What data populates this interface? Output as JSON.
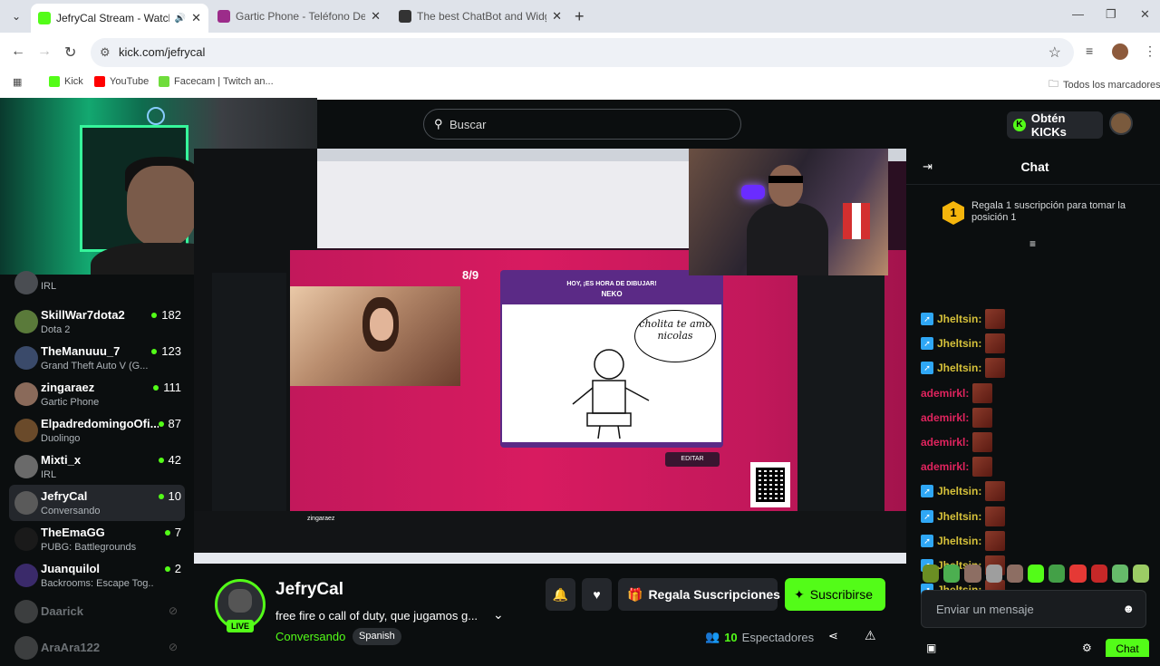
{
  "browser": {
    "tabs": [
      {
        "title": "JefryCal Stream - Watch Live",
        "active": true,
        "favicon_color": "#53fc18"
      },
      {
        "title": "Gartic Phone - Teléfono Descompuesto",
        "active": false,
        "favicon_color": "#9c2c8a"
      },
      {
        "title": "The best ChatBot and Widgets",
        "active": false,
        "favicon_color": "#333333"
      }
    ],
    "url": "kick.com/jefrycal",
    "bookmarks": [
      {
        "label": "Kick",
        "icon_color": "#53fc18"
      },
      {
        "label": "YouTube",
        "icon_color": "#ff0000"
      },
      {
        "label": "Facecam | Twitch an...",
        "icon_color": "#6fdc3c"
      }
    ],
    "all_bookmarks": "Todos los marcadores"
  },
  "header": {
    "search_placeholder": "Buscar",
    "kicks_label": "Obtén KICKs"
  },
  "sidebar": {
    "channels": [
      {
        "name": "",
        "category": "IRL",
        "viewers": "",
        "avatar_color": "#4a4d52",
        "partial": true
      },
      {
        "name": "SkillWar7dota2",
        "category": "Dota 2",
        "viewers": "182",
        "avatar_color": "#5a7a3a"
      },
      {
        "name": "TheManuuu_7",
        "category": "Grand Theft Auto V (G...",
        "viewers": "123",
        "avatar_color": "#3a4a6a"
      },
      {
        "name": "zingaraez",
        "category": "Gartic Phone",
        "viewers": "111",
        "avatar_color": "#8a6a5a"
      },
      {
        "name": "ElpadredomingoOfi...",
        "category": "Duolingo",
        "viewers": "87",
        "avatar_color": "#6a4a2a"
      },
      {
        "name": "Mixti_x",
        "category": "IRL",
        "viewers": "42",
        "avatar_color": "#6a6a6a"
      },
      {
        "name": "JefryCal",
        "category": "Conversando",
        "viewers": "10",
        "avatar_color": "#5a5a5a",
        "selected": true
      },
      {
        "name": "TheEmaGG",
        "category": "PUBG: Battlegrounds",
        "viewers": "7",
        "avatar_color": "#1a1a1a"
      },
      {
        "name": "Juanquilol",
        "category": "Backrooms: Escape Tog...",
        "viewers": "2",
        "avatar_color": "#3a2a6a"
      },
      {
        "name": "Daarick",
        "category": "",
        "viewers": "",
        "avatar_color": "#888888",
        "offline": true
      },
      {
        "name": "AraAra122",
        "category": "",
        "viewers": "",
        "avatar_color": "#888888",
        "offline": true
      }
    ]
  },
  "video": {
    "round": "8/9",
    "game_header": "HOY, ¡ES HORA DE DIBUJAR!",
    "prompt": "NEKO",
    "drawing_text": "cholita te amo nicolas",
    "edit_label": "EDITAR",
    "streamer_in_video": "zingaraez"
  },
  "stream": {
    "name": "JefryCal",
    "live_label": "LIVE",
    "title": "free fire o call of duty, que jugamos g...",
    "category": "Conversando",
    "language": "Spanish",
    "gift_label": "Regala Suscripciones",
    "subscribe_label": "Suscribirse",
    "viewers_count": "10",
    "viewers_label": "Espectadores"
  },
  "chat": {
    "title": "Chat",
    "pinned_rank": "1",
    "pinned_text": "Regala 1 suscripción para tomar la posición 1",
    "messages": [
      {
        "user": "Jheltsin:",
        "color": "#d6c13a",
        "badge": true
      },
      {
        "user": "Jheltsin:",
        "color": "#d6c13a",
        "badge": true
      },
      {
        "user": "Jheltsin:",
        "color": "#d6c13a",
        "badge": true
      },
      {
        "user": "ademirkl:",
        "color": "#e0245e",
        "badge": false
      },
      {
        "user": "ademirkl:",
        "color": "#e0245e",
        "badge": false
      },
      {
        "user": "ademirkl:",
        "color": "#e0245e",
        "badge": false
      },
      {
        "user": "ademirkl:",
        "color": "#e0245e",
        "badge": false
      },
      {
        "user": "Jheltsin:",
        "color": "#d6c13a",
        "badge": true
      },
      {
        "user": "Jheltsin:",
        "color": "#d6c13a",
        "badge": true
      },
      {
        "user": "Jheltsin:",
        "color": "#d6c13a",
        "badge": true
      },
      {
        "user": "Jheltsin:",
        "color": "#d6c13a",
        "badge": true
      },
      {
        "user": "Jheltsin:",
        "color": "#d6c13a",
        "badge": true
      }
    ],
    "input_placeholder": "Enviar un mensaje",
    "send_label": "Chat",
    "emote_colors": [
      "#6b8e23",
      "#4caf50",
      "#8d6e63",
      "#9e9e9e",
      "#8d6e63",
      "#53fc18",
      "#43a047",
      "#e53935",
      "#c62828",
      "#66bb6a",
      "#9ccc65"
    ]
  },
  "accent": "#53fc18"
}
